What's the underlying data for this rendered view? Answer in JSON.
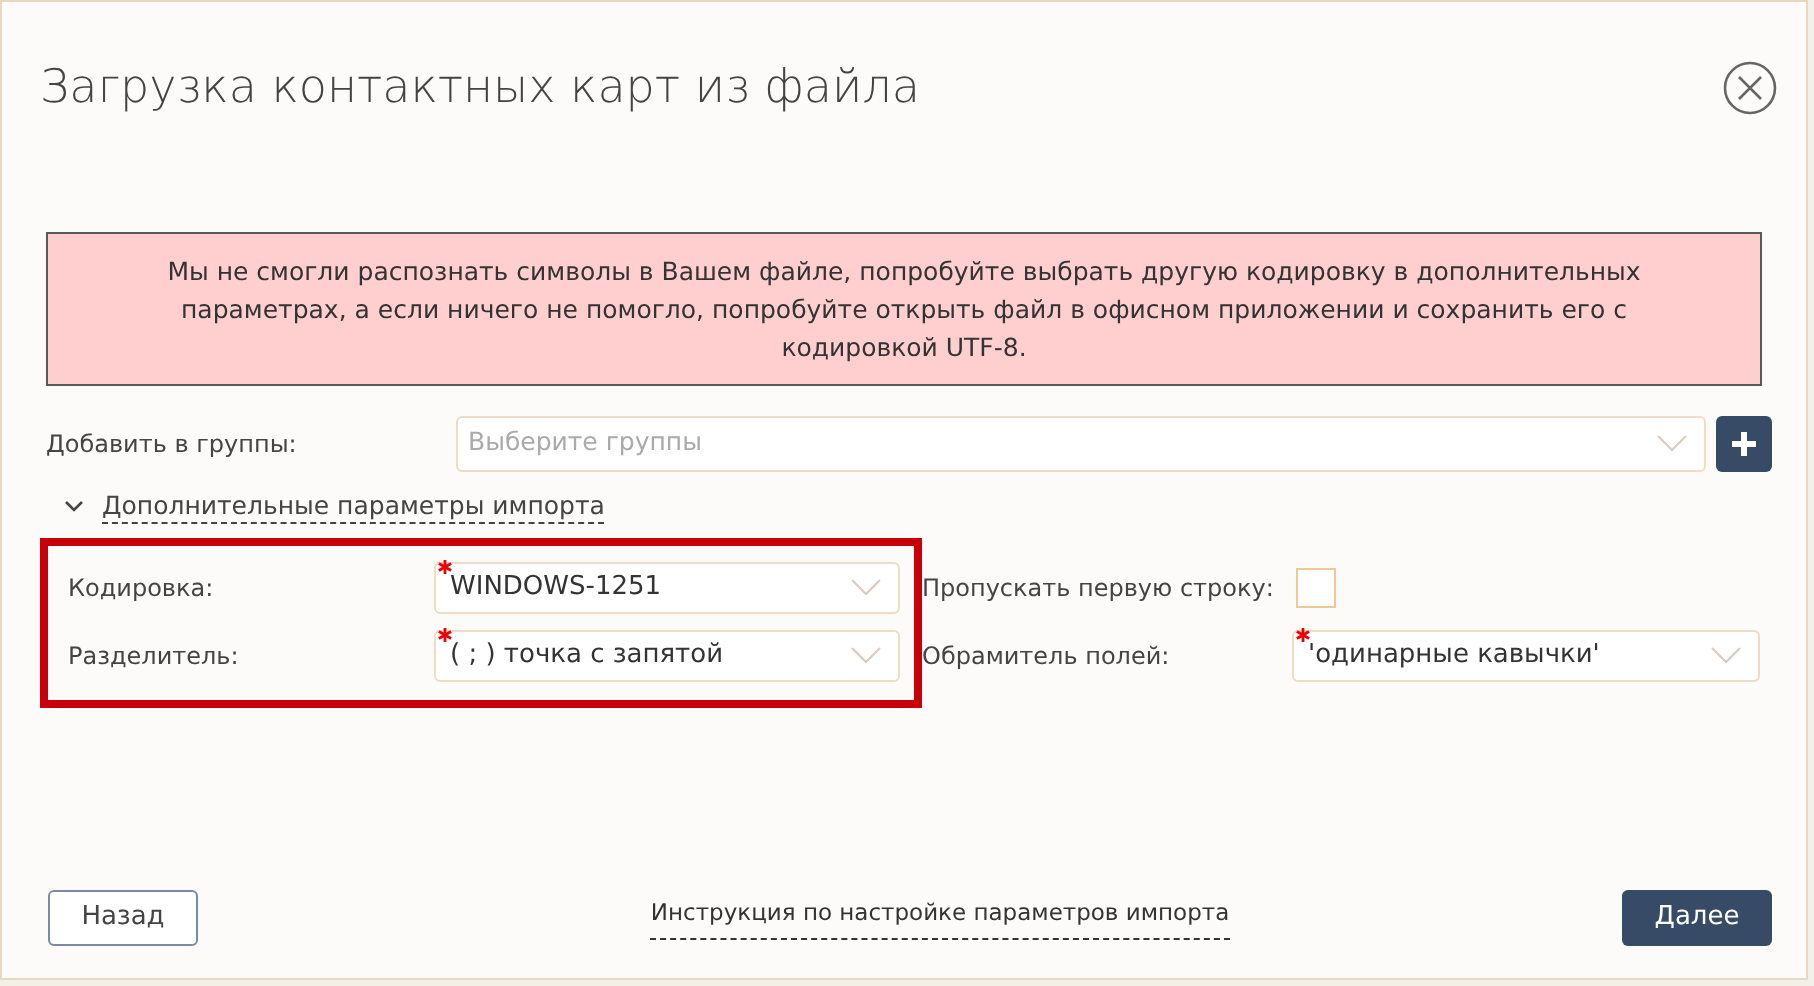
{
  "dialog": {
    "title": "Загрузка контактных карт из файла"
  },
  "alert": {
    "text": "Мы не смогли распознать символы в Вашем файле, попробуйте выбрать другую кодировку в дополнительных параметрах, а если ничего не помогло, попробуйте открыть файл в офисном приложении и сохранить его с кодировкой UTF-8."
  },
  "groups": {
    "label": "Добавить в группы:",
    "placeholder": "Выберите группы"
  },
  "advanced": {
    "label": "Дополнительные параметры импорта",
    "expanded": true,
    "left_fields": [
      {
        "label": "Кодировка:",
        "value": "WINDOWS-1251",
        "required": true
      },
      {
        "label": "Разделитель:",
        "value": "( ; ) точка с запятой",
        "required": true
      }
    ],
    "skip_first_row": {
      "label": "Пропускать первую строку:",
      "checked": false
    },
    "quote": {
      "label": "Обрамитель полей:",
      "value": "'одинарные кавычки'",
      "required": true
    }
  },
  "footer": {
    "back": "Назад",
    "help_link": "Инструкция по настройке параметров импорта",
    "next": "Далее"
  }
}
